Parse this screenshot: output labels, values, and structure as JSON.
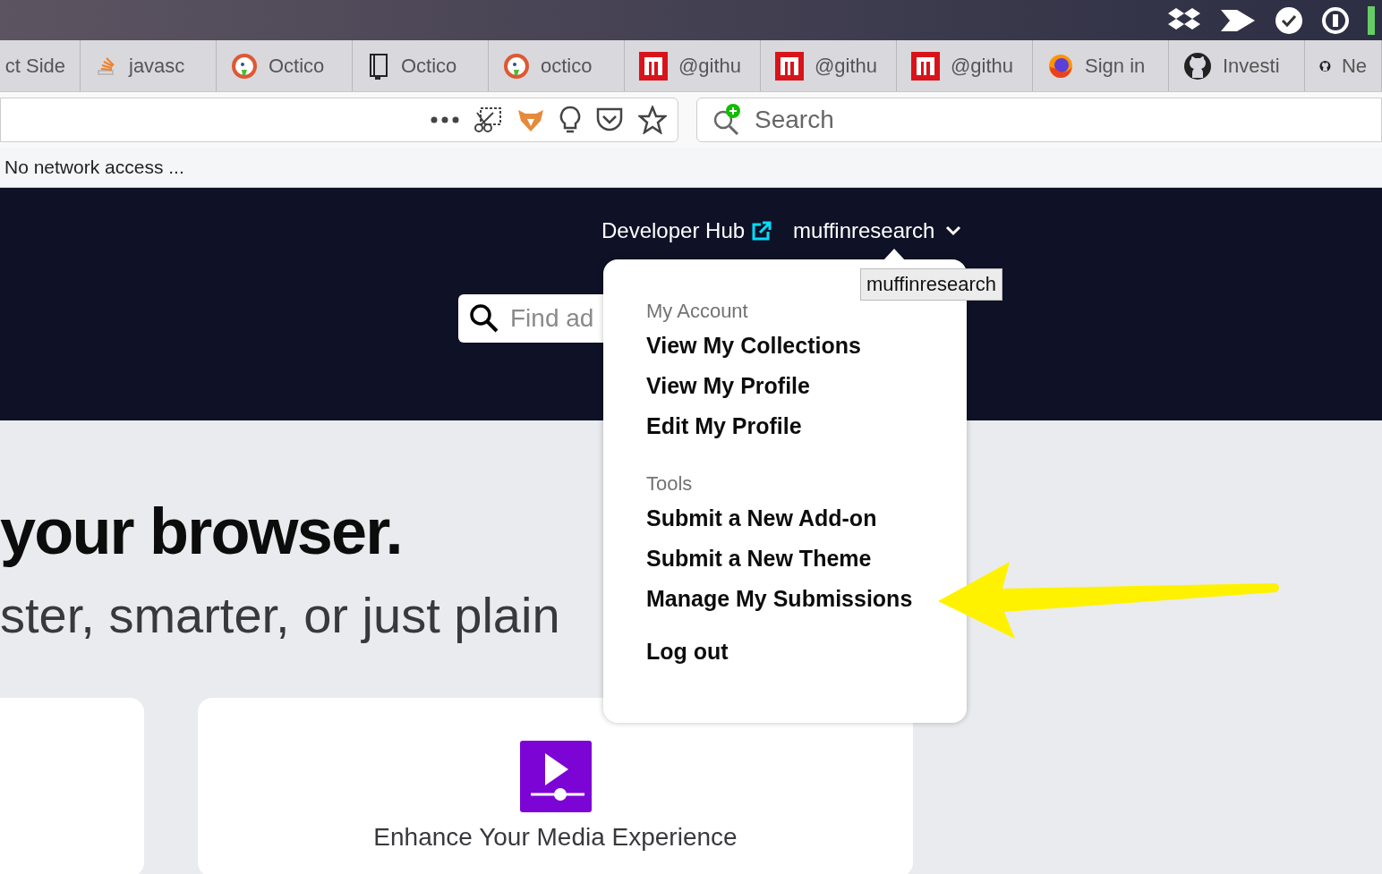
{
  "browser": {
    "tabs": [
      {
        "label": "ct Side",
        "kind": "blank"
      },
      {
        "label": "javasc",
        "kind": "stack"
      },
      {
        "label": "Octico",
        "kind": "duck"
      },
      {
        "label": "Octico",
        "kind": "book"
      },
      {
        "label": "octico",
        "kind": "duck"
      },
      {
        "label": "@githu",
        "kind": "n"
      },
      {
        "label": "@githu",
        "kind": "n"
      },
      {
        "label": "@githu",
        "kind": "n"
      },
      {
        "label": "Sign in",
        "kind": "firefox"
      },
      {
        "label": "Investi",
        "kind": "github"
      },
      {
        "label": "Ne",
        "kind": "github"
      }
    ],
    "search": {
      "placeholder": "Search"
    },
    "status": "No network access ..."
  },
  "header": {
    "developer_hub": "Developer Hub",
    "user": "muffinresearch",
    "search": {
      "placeholder": "Find ad"
    }
  },
  "tooltip": "muffinresearch",
  "menu": {
    "sections": [
      {
        "heading": "My Account",
        "items": [
          "View My Collections",
          "View My Profile",
          "Edit My Profile"
        ]
      },
      {
        "heading": "Tools",
        "items": [
          "Submit a New Add-on",
          "Submit a New Theme",
          "Manage My Submissions"
        ]
      },
      {
        "items": [
          "Log out"
        ]
      }
    ]
  },
  "hero": {
    "title": "your browser.",
    "subtitle": "ster, smarter, or just plain"
  },
  "cards": [
    {
      "kind": "blank"
    },
    {
      "kind": "feature",
      "title": "Enhance Your Media Experience"
    }
  ]
}
